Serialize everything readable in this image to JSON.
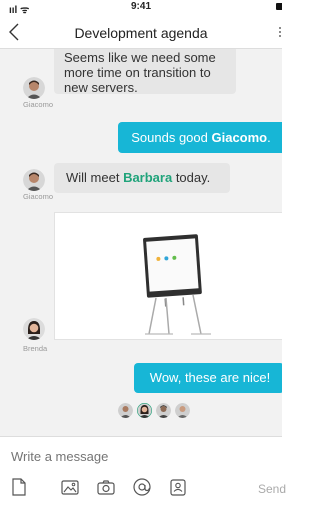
{
  "status_bar": {
    "time": "9:41",
    "signal": "ııl ᯤ"
  },
  "header": {
    "title": "Development agenda",
    "back_icon": "chevron-left-icon",
    "more_icon": "more-vertical-icon"
  },
  "messages": [
    {
      "sender": "Giacomo",
      "text": "Seems like we need some more time on transition to new servers."
    },
    {
      "text_prefix": "Sounds good ",
      "mention": "Giacomo",
      "text_suffix": "."
    },
    {
      "sender": "Giacomo",
      "text_prefix": "Will meet ",
      "highlight": "Barbara",
      "text_suffix": " today."
    },
    {
      "sender": "Brenda",
      "attachment": "whiteboard-image"
    },
    {
      "text": "Wow, these are nice!"
    }
  ],
  "composer": {
    "placeholder": "Write a message",
    "send_label": "Send",
    "tools": [
      "file-icon",
      "image-icon",
      "camera-icon",
      "mention-icon",
      "contact-card-icon"
    ]
  },
  "colors": {
    "outgoing": "#17b6d6",
    "highlight": "#1fa37a"
  }
}
